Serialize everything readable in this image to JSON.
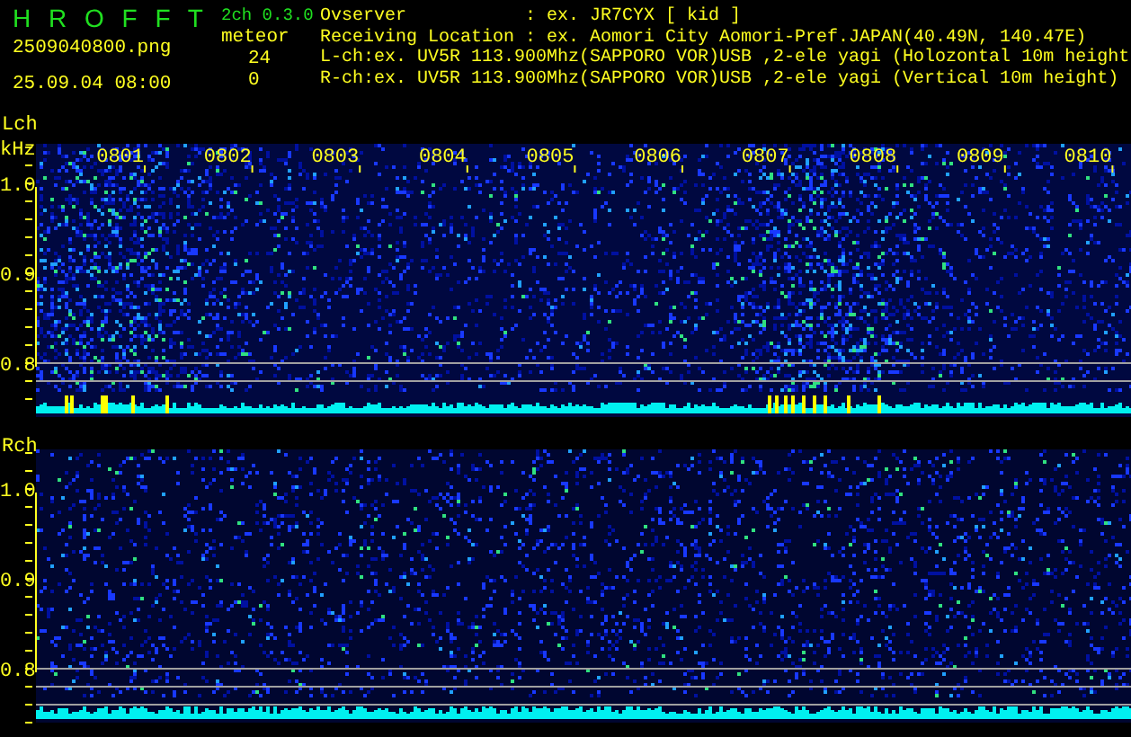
{
  "header": {
    "app_title": "H R O F F T",
    "version": "2ch 0.3.0",
    "filename": "2509040800.png",
    "datetime": "25.09.04 08:00",
    "meteor_label": "meteor",
    "counts": [
      "24",
      "0"
    ],
    "info_lines": [
      "Ovserver           : ex. JR7CYX [ kid ]",
      "Receiving Location : ex. Aomori City Aomori-Pref.JAPAN(40.49N, 140.47E)",
      "L-ch:ex. UV5R 113.900Mhz(SAPPORO VOR)USB ,2-ele yagi (Holozontal 10m height",
      "R-ch:ex. UV5R 113.900Mhz(SAPPORO VOR)USB ,2-ele yagi (Vertical 10m height)"
    ]
  },
  "panels": [
    {
      "channel": "Lch",
      "unit": "kHz",
      "time_labels": [
        "0801",
        "0802",
        "0803",
        "0804",
        "0805",
        "0806",
        "0807",
        "0808",
        "0809",
        "0810"
      ],
      "y_labels": [
        "1.0",
        "0.9",
        "0.8"
      ]
    },
    {
      "channel": "Rch",
      "y_labels": [
        "1.0",
        "0.9",
        "0.8"
      ]
    }
  ]
}
